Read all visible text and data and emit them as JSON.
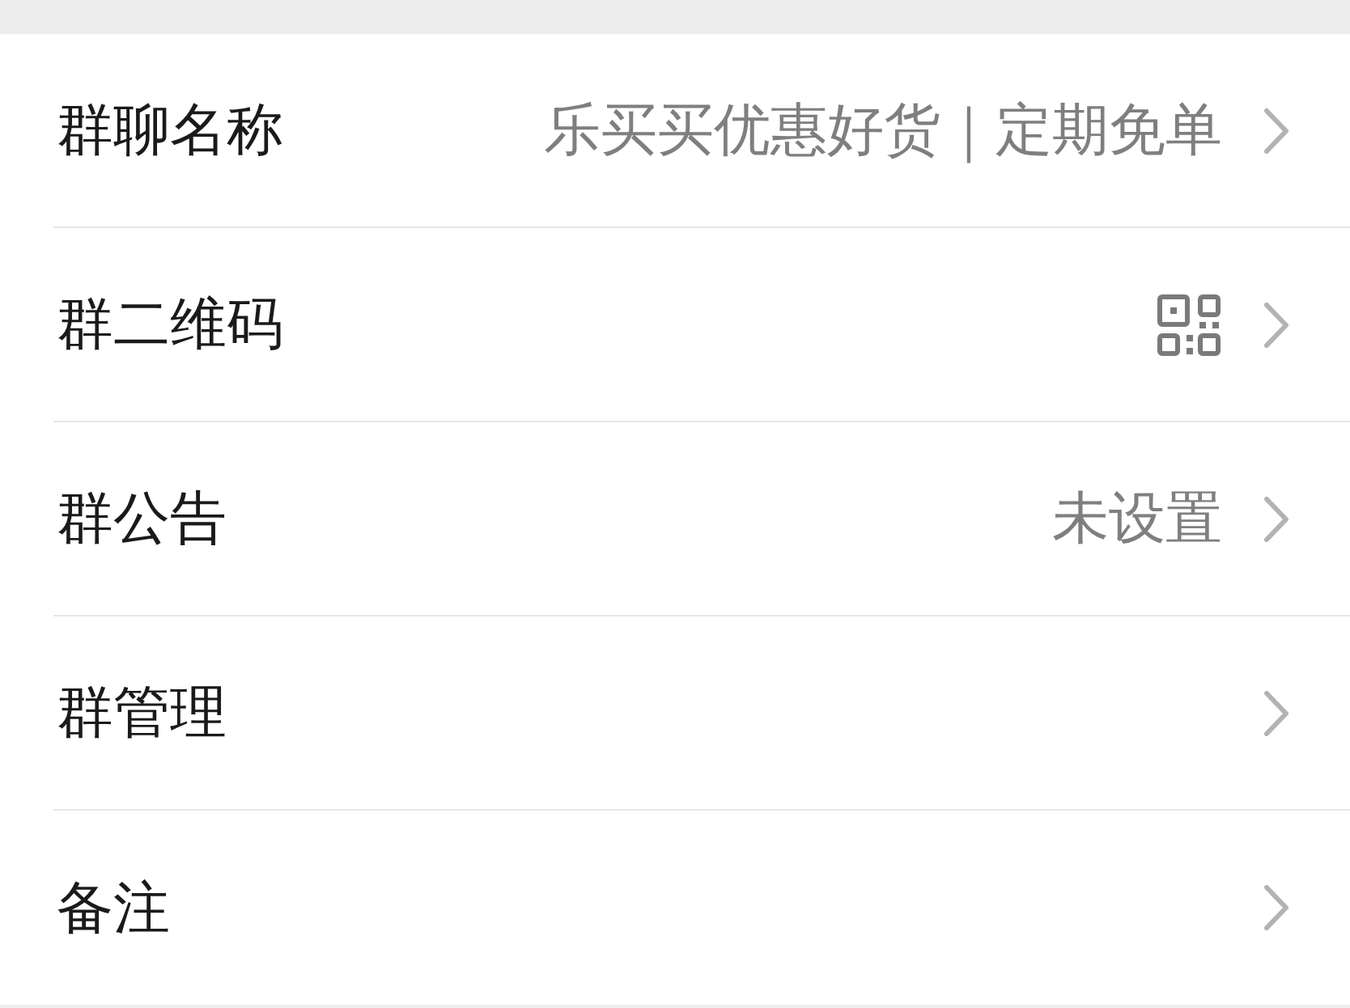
{
  "rows": [
    {
      "kind": "text",
      "label": "群聊名称",
      "value": "乐买买优惠好货｜定期免单"
    },
    {
      "kind": "qr",
      "label": "群二维码"
    },
    {
      "kind": "text",
      "label": "群公告",
      "value": "未设置"
    },
    {
      "kind": "plain",
      "label": "群管理"
    },
    {
      "kind": "plain",
      "label": "备注"
    }
  ]
}
